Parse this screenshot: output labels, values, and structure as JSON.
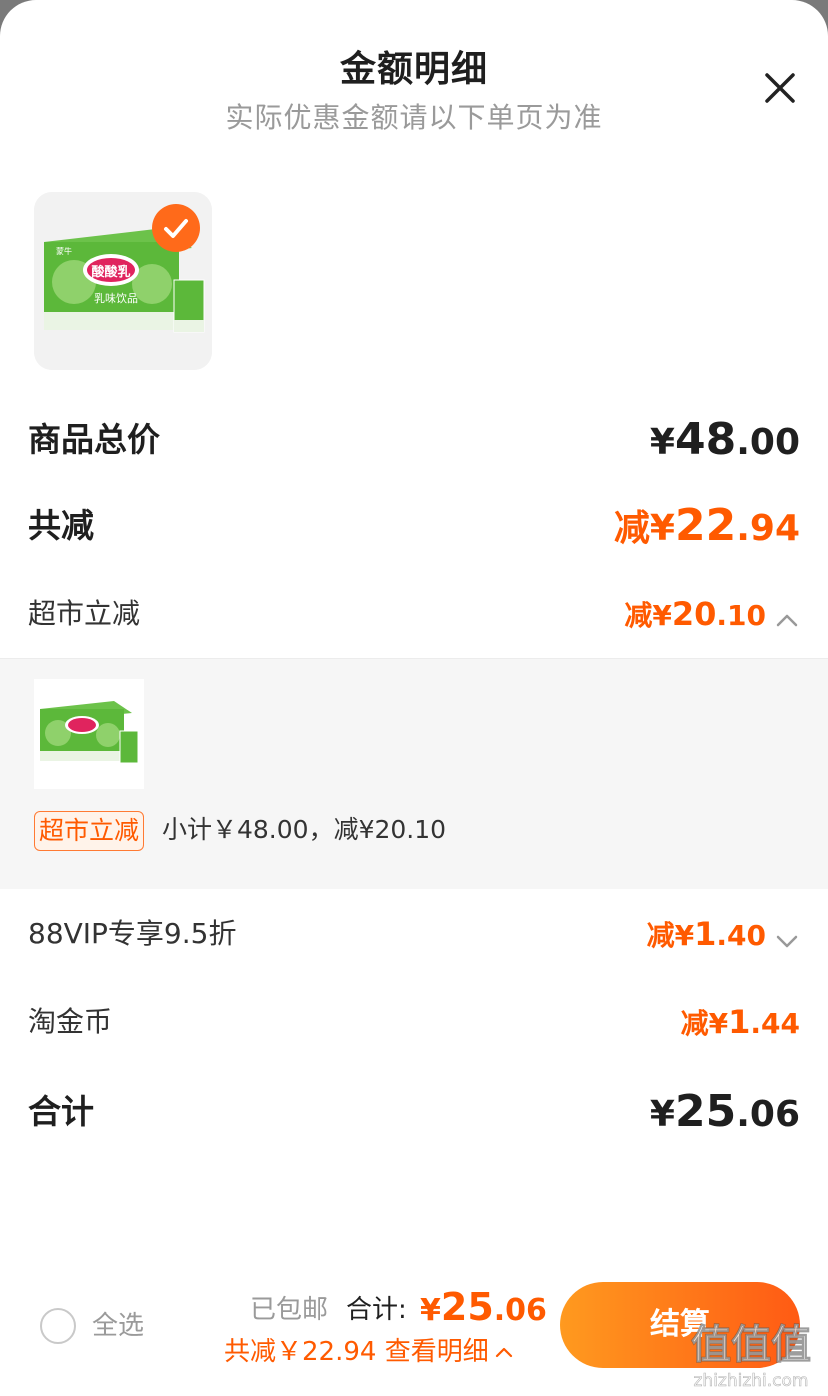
{
  "header": {
    "title": "金额明细",
    "subtitle": "实际优惠金额请以下单页为准"
  },
  "summary": {
    "goods_total": {
      "label": "商品总价",
      "yen": "¥",
      "int": "48",
      "dec": ".00"
    },
    "total_reduce": {
      "label": "共减",
      "prefix": "减",
      "yen": "¥",
      "int": "22",
      "dec": ".94"
    },
    "supermarket": {
      "label": "超市立减",
      "prefix": "减",
      "yen": "¥",
      "int": "20",
      "dec": ".10"
    },
    "vip": {
      "label": "88VIP专享9.5折",
      "prefix": "减",
      "yen": "¥",
      "int": "1",
      "dec": ".40"
    },
    "coins": {
      "label": "淘金币",
      "prefix": "减",
      "yen": "¥",
      "int": "1",
      "dec": ".44"
    },
    "total": {
      "label": "合计",
      "yen": "¥",
      "int": "25",
      "dec": ".06"
    }
  },
  "detail": {
    "tag": "超市立减",
    "subtotal_text": "小计￥48.00，减¥20.10"
  },
  "product": {
    "brand": "蒙牛",
    "name": "酸酸乳",
    "subname": "乳味饮品"
  },
  "bottom": {
    "select_all": "全选",
    "shipping": "已包邮",
    "total_label": "合计:",
    "total_yen": "¥",
    "total_int": "25",
    "total_dec": ".06",
    "saving_text": "共减￥22.94 查看明细",
    "checkout": "结算"
  },
  "watermark": {
    "text": "值值值",
    "url": "zhizhizhi.com"
  },
  "colors": {
    "accent": "#ff5a00",
    "check": "#ff6a1a",
    "product_green": "#5cb83a"
  }
}
